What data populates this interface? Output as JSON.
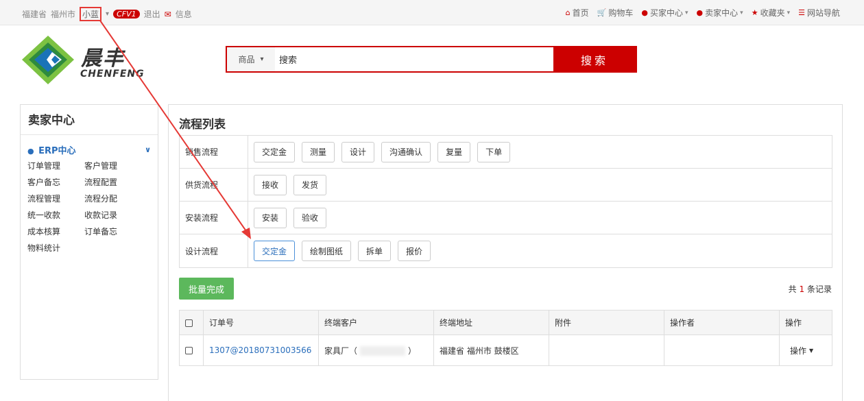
{
  "topbar": {
    "province": "福建省",
    "city": "福州市",
    "username": "小蓝",
    "vip_badge": "CFV1",
    "logout": "退出",
    "messages": "信息",
    "nav": [
      {
        "label": "首页",
        "icon": "home-icon"
      },
      {
        "label": "购物车",
        "icon": "cart-icon"
      },
      {
        "label": "买家中心",
        "icon": "user-icon",
        "dropdown": true
      },
      {
        "label": "卖家中心",
        "icon": "user-icon",
        "dropdown": true
      },
      {
        "label": "收藏夹",
        "icon": "star-icon",
        "dropdown": true
      },
      {
        "label": "网站导航",
        "icon": "list-icon"
      }
    ]
  },
  "logo": {
    "cn": "晨丰",
    "en": "CHENFENG"
  },
  "search": {
    "category": "商品",
    "value": "搜索",
    "button": "搜索"
  },
  "sidebar": {
    "title": "卖家中心",
    "group": "ERP中心",
    "links": [
      "订单管理",
      "客户管理",
      "客户备忘",
      "流程配置",
      "流程管理",
      "流程分配",
      "统一收款",
      "收款记录",
      "成本核算",
      "订单备忘",
      "物料统计"
    ]
  },
  "main": {
    "title": "流程列表",
    "flows": [
      {
        "label": "销售流程",
        "steps": [
          "交定金",
          "测量",
          "设计",
          "沟通确认",
          "复量",
          "下单"
        ]
      },
      {
        "label": "供货流程",
        "steps": [
          "接收",
          "发货"
        ]
      },
      {
        "label": "安装流程",
        "steps": [
          "安装",
          "验收"
        ]
      },
      {
        "label": "设计流程",
        "steps": [
          "交定金",
          "绘制图纸",
          "拆单",
          "报价"
        ],
        "active": 0
      }
    ],
    "batch_button": "批量完成",
    "record_prefix": "共",
    "record_count": "1",
    "record_suffix": "条记录",
    "table": {
      "headers": [
        "订单号",
        "终端客户",
        "终端地址",
        "附件",
        "操作者",
        "操作"
      ],
      "rows": [
        {
          "order": "1307@20180731003566",
          "customer_prefix": "家具厂（",
          "customer_suffix": "）",
          "address": "福建省 福州市 鼓楼区",
          "attachment": "",
          "operator": "",
          "action": "操作"
        }
      ]
    }
  },
  "colors": {
    "brand": "#cc0000",
    "link": "#2a6ebb",
    "success": "#5cb85c",
    "annotation": "#e53935"
  }
}
